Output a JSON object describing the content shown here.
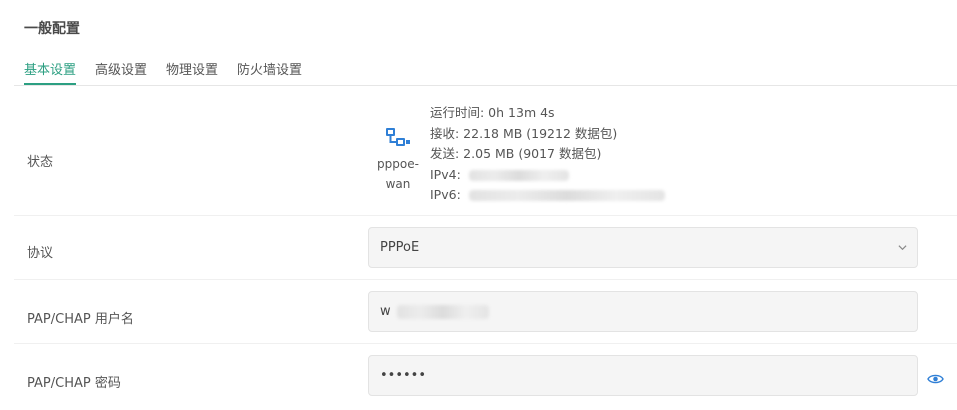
{
  "section": {
    "title": "一般配置"
  },
  "tabs": [
    {
      "label": "基本设置",
      "active": true
    },
    {
      "label": "高级设置",
      "active": false
    },
    {
      "label": "物理设置",
      "active": false
    },
    {
      "label": "防火墙设置",
      "active": false
    }
  ],
  "status": {
    "label": "状态",
    "iface_icon": "network-interface-icon",
    "iface_name": "pppoe-wan",
    "uptime": "运行时间: 0h 13m 4s",
    "rx": "接收: 22.18 MB (19212 数据包)",
    "tx": "发送: 2.05 MB (9017 数据包)",
    "ipv4_label": "IPv4:",
    "ipv6_label": "IPv6:"
  },
  "protocol": {
    "label": "协议",
    "value": "PPPoE",
    "icon": "chevron-down-icon"
  },
  "username": {
    "label": "PAP/CHAP 用户名",
    "value": "w"
  },
  "password": {
    "label": "PAP/CHAP 密码",
    "value": "••••••",
    "icon": "eye-icon"
  },
  "colors": {
    "accent": "#2c9f82",
    "icon_blue": "#2f7fd6"
  }
}
